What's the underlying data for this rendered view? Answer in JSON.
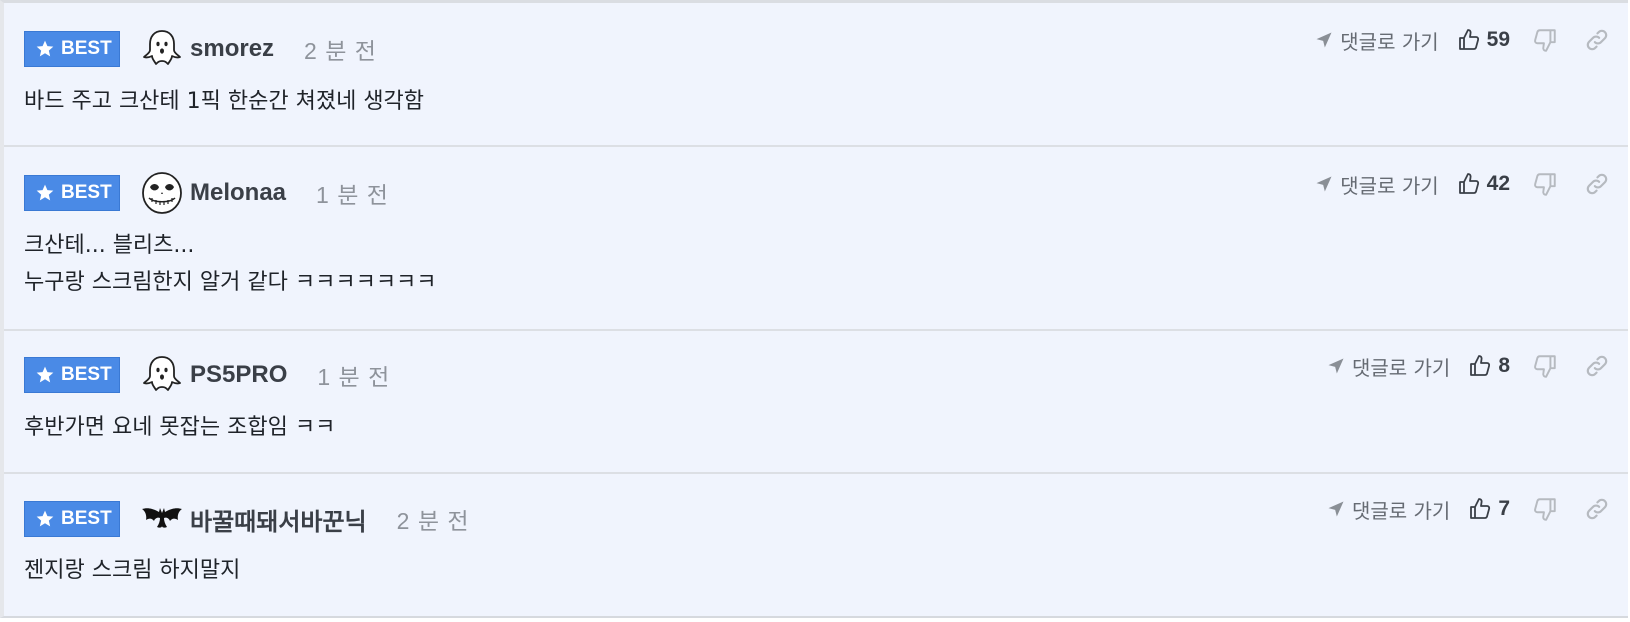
{
  "comments": [
    {
      "badge": "BEST",
      "avatar": "ghost-icon",
      "username": "smorez",
      "time": "2 분 전",
      "lines": [
        "바드 주고 크산테 1픽 한순간 쳐졌네 생각함"
      ],
      "goto_label": "댓글로 가기",
      "likes": "59"
    },
    {
      "badge": "BEST",
      "avatar": "skull-face-icon",
      "username": "Melonaa",
      "time": "1 분 전",
      "lines": [
        "크산테... 블리츠...",
        "누구랑 스크림한지 알거 같다 ㅋㅋㅋㅋㅋㅋㅋ"
      ],
      "goto_label": "댓글로 가기",
      "likes": "42"
    },
    {
      "badge": "BEST",
      "avatar": "ghost-icon",
      "username": "PS5PRO",
      "time": "1 분 전",
      "lines": [
        "후반가면 요네 못잡는 조합임 ㅋㅋ"
      ],
      "goto_label": "댓글로 가기",
      "likes": "8"
    },
    {
      "badge": "BEST",
      "avatar": "bat-icon",
      "username": "바꿀때돼서바꾼닉",
      "time": "2 분 전",
      "lines": [
        "젠지랑 스크림 하지말지"
      ],
      "goto_label": "댓글로 가기",
      "likes": "7"
    }
  ],
  "colors": {
    "badge_bg": "#4a8ae6",
    "row_bg": "#f0f4fd",
    "username": "#3a3f47",
    "time": "#8e939b"
  }
}
